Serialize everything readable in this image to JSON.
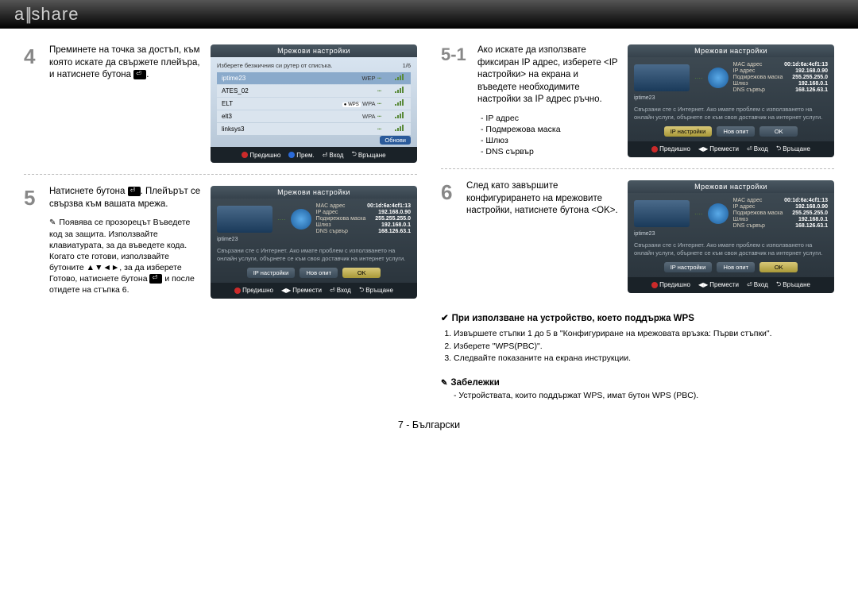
{
  "header": {
    "logo_pre": "a",
    "logo_post": "share"
  },
  "left": {
    "step4": {
      "num": "4",
      "text": "Преминете на точка за достъп, към която искате да свържете плейъра, и натиснете бутона"
    },
    "step5": {
      "num": "5",
      "text1": "Натиснете бутона",
      "text2": ". Плейърът се свързва към вашата мрежа.",
      "subnote": "Появява се прозорецът Въведете код за защита. Използвайте клавиатурата, за да въведете кода. Когато сте готови, използвайте бутоните ▲▼◄►, за да изберете Готово, натиснете бутона",
      "subnote2": " и после отидете на стъпка 6."
    },
    "ss4": {
      "title": "Мрежови настройки",
      "prompt": "Изберете безжичния си рутер от списъка.",
      "page": "1/6",
      "rows": [
        {
          "name": "iptime23",
          "sec": "WEP"
        },
        {
          "name": "ATES_02"
        },
        {
          "name": "ELT",
          "sec": "WPA"
        },
        {
          "name": "elt3",
          "sec": "WPA"
        },
        {
          "name": "linksys3"
        }
      ],
      "refresh": "Обнови",
      "foot": {
        "a": "Предишно",
        "b": "Прем.",
        "c": "Вход",
        "d": "Връщане"
      }
    },
    "ss5": {
      "title": "Мрежови настройки",
      "device": "iptime23",
      "kv": [
        {
          "k": "MAC адрес",
          "v": "00:1d:6a:4cf1:13"
        },
        {
          "k": "IP адрес",
          "v": "192.168.0.90"
        },
        {
          "k": "Подмрежова маска",
          "v": "255.255.255.0"
        },
        {
          "k": "Шлюз",
          "v": "192.168.0.1"
        },
        {
          "k": "DNS сървър",
          "v": "168.126.63.1"
        }
      ],
      "note": "Свързани сте с Интернет. Ако имате проблем с използването на онлайн услуги, обърнете се към своя доставчик на интернет услуги.",
      "buttons": {
        "ip": "IP настройки",
        "retry": "Нов опит",
        "ok": "OK"
      },
      "foot": {
        "a": "Предишно",
        "b": "Премести",
        "c": "Вход",
        "d": "Връщане"
      }
    }
  },
  "right": {
    "step51": {
      "num": "5-1",
      "text": "Ако искате да използвате фиксиран IP адрес, изберете <IP настройки> на екрана и въведете необходимите настройки за IP адрес ръчно.",
      "bullets": [
        "IP адрес",
        "Подмрежова маска",
        "Шлюз",
        "DNS сървър"
      ]
    },
    "step6": {
      "num": "6",
      "text": "След като завършите конфигурирането на мрежовите настройки, натиснете бутона <OK>."
    },
    "ss51": {
      "title": "Мрежови настройки",
      "device": "iptime23",
      "kv": [
        {
          "k": "MAC адрес",
          "v": "00:1d:6a:4cf1:13"
        },
        {
          "k": "IP адрес",
          "v": "192.168.0.90"
        },
        {
          "k": "Подмрежова маска",
          "v": "255.255.255.0"
        },
        {
          "k": "Шлюз",
          "v": "192.168.0.1"
        },
        {
          "k": "DNS сървър",
          "v": "168.126.63.1"
        }
      ],
      "note": "Свързани сте с Интернет. Ако имате проблем с използването на онлайн услуги, обърнете се към своя доставчик на интернет услуги.",
      "buttons": {
        "ip": "IP настройки",
        "retry": "Нов опит",
        "ok": "OK"
      },
      "foot": {
        "a": "Предишно",
        "b": "Премести",
        "c": "Вход",
        "d": "Връщане"
      }
    },
    "ss6": {
      "title": "Мрежови настройки",
      "device": "iptime23",
      "kv": [
        {
          "k": "MAC адрес",
          "v": "00:1d:6a:4cf1:13"
        },
        {
          "k": "IP адрес",
          "v": "192.168.0.90"
        },
        {
          "k": "Подмрежова маска",
          "v": "255.255.255.0"
        },
        {
          "k": "Шлюз",
          "v": "192.168.0.1"
        },
        {
          "k": "DNS сървър",
          "v": "168.126.63.1"
        }
      ],
      "note": "Свързани сте с Интернет. Ако имате проблем с използването на онлайн услуги, обърнете се към своя доставчик на интернет услуги.",
      "buttons": {
        "ip": "IP настройки",
        "retry": "Нов опит",
        "ok": "OK"
      },
      "foot": {
        "a": "Предишно",
        "b": "Премести",
        "c": "Вход",
        "d": "Връщане"
      }
    },
    "wps": {
      "title": "При използване на устройство, което поддържа WPS",
      "items": [
        "Извършете стъпки 1 до 5 в \"Конфигуриране на мрежовата връзка: Първи стъпки\".",
        "Изберете \"WPS(PBC)\".",
        "Следвайте показаните на екрана инструкции."
      ]
    },
    "notes": {
      "title": "Забележки",
      "items": [
        "Устройствата, които поддържат WPS, имат бутон WPS (PBC)."
      ]
    }
  },
  "footer": "7  -  Български"
}
